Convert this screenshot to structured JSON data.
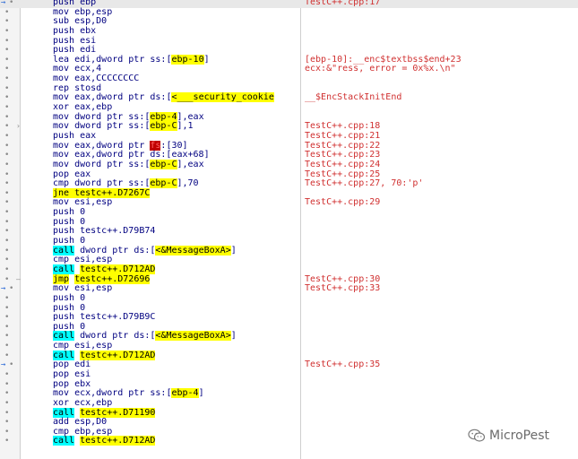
{
  "rows": [
    {
      "gutter": "arrow-dot",
      "ins": [
        {
          "t": "push ebp",
          "c": "blue"
        }
      ],
      "cmt": "TestC++.cpp:17",
      "sel": true
    },
    {
      "gutter": "dot",
      "ins": [
        {
          "t": "mov ebp,esp",
          "c": "blue"
        }
      ],
      "cmt": ""
    },
    {
      "gutter": "dot",
      "ins": [
        {
          "t": "sub esp,D0",
          "c": "blue"
        }
      ],
      "cmt": ""
    },
    {
      "gutter": "dot",
      "ins": [
        {
          "t": "push ebx",
          "c": "blue"
        }
      ],
      "cmt": ""
    },
    {
      "gutter": "dot",
      "ins": [
        {
          "t": "push esi",
          "c": "blue"
        }
      ],
      "cmt": ""
    },
    {
      "gutter": "dot",
      "ins": [
        {
          "t": "push edi",
          "c": "blue"
        }
      ],
      "cmt": ""
    },
    {
      "gutter": "dot",
      "ins": [
        {
          "t": "lea edi,dword ptr ss:",
          "c": "blue"
        },
        {
          "t": "[",
          "c": "blue"
        },
        {
          "t": "ebp-10",
          "c": "hl-y"
        },
        {
          "t": "]",
          "c": "blue"
        }
      ],
      "cmt": "[ebp-10]:__enc$textbss$end+23"
    },
    {
      "gutter": "dot",
      "ins": [
        {
          "t": "mov ecx,4",
          "c": "blue"
        }
      ],
      "cmt": "ecx:&\"ress, error = 0x%x.\\n\""
    },
    {
      "gutter": "dot",
      "ins": [
        {
          "t": "mov eax,CCCCCCCC",
          "c": "blue"
        }
      ],
      "cmt": ""
    },
    {
      "gutter": "dot",
      "ins": [
        {
          "t": "rep stosd",
          "c": "blue"
        }
      ],
      "cmt": ""
    },
    {
      "gutter": "dot",
      "ins": [
        {
          "t": "mov eax,dword ptr ds:",
          "c": "blue"
        },
        {
          "t": "[",
          "c": "blue"
        },
        {
          "t": "<___security_cookie",
          "c": "hl-y"
        }
      ],
      "cmt": "__$EncStackInitEnd"
    },
    {
      "gutter": "dot",
      "ins": [
        {
          "t": "xor eax,ebp",
          "c": "blue"
        }
      ],
      "cmt": ""
    },
    {
      "gutter": "dot",
      "ins": [
        {
          "t": "mov dword ptr ss:",
          "c": "blue"
        },
        {
          "t": "[",
          "c": "blue"
        },
        {
          "t": "ebp-4",
          "c": "hl-y"
        },
        {
          "t": "],eax",
          "c": "blue"
        }
      ],
      "cmt": ""
    },
    {
      "gutter": "dot-tick",
      "ins": [
        {
          "t": "mov dword ptr ss:",
          "c": "blue"
        },
        {
          "t": "[",
          "c": "blue"
        },
        {
          "t": "ebp-C",
          "c": "hl-y"
        },
        {
          "t": "],1",
          "c": "blue"
        }
      ],
      "cmt": "TestC++.cpp:18"
    },
    {
      "gutter": "dot",
      "ins": [
        {
          "t": "push eax",
          "c": "blue"
        }
      ],
      "cmt": "TestC++.cpp:21"
    },
    {
      "gutter": "dot",
      "ins": [
        {
          "t": "mov eax,dword ptr ",
          "c": "blue"
        },
        {
          "t": "fs",
          "c": "hl-r"
        },
        {
          "t": ":[30]",
          "c": "blue"
        }
      ],
      "cmt": "TestC++.cpp:22"
    },
    {
      "gutter": "dot",
      "ins": [
        {
          "t": "mov eax,dword ptr ds:[eax+68]",
          "c": "blue"
        }
      ],
      "cmt": "TestC++.cpp:23"
    },
    {
      "gutter": "dot",
      "ins": [
        {
          "t": "mov dword ptr ss:",
          "c": "blue"
        },
        {
          "t": "[",
          "c": "blue"
        },
        {
          "t": "ebp-C",
          "c": "hl-y"
        },
        {
          "t": "],eax",
          "c": "blue"
        }
      ],
      "cmt": "TestC++.cpp:24"
    },
    {
      "gutter": "dot",
      "ins": [
        {
          "t": "pop eax",
          "c": "blue"
        }
      ],
      "cmt": "TestC++.cpp:25"
    },
    {
      "gutter": "dot",
      "ins": [
        {
          "t": "cmp dword ptr ss:",
          "c": "blue"
        },
        {
          "t": "[",
          "c": "blue"
        },
        {
          "t": "ebp-C",
          "c": "hl-y"
        },
        {
          "t": "],70",
          "c": "blue"
        }
      ],
      "cmt": "TestC++.cpp:27, 70:'p'"
    },
    {
      "gutter": "dot",
      "ins": [
        {
          "t": "jne testc++.D7267C",
          "c": "hl-y"
        }
      ],
      "cmt": ""
    },
    {
      "gutter": "dot",
      "ins": [
        {
          "t": "mov esi,esp",
          "c": "blue"
        }
      ],
      "cmt": "TestC++.cpp:29"
    },
    {
      "gutter": "dot",
      "ins": [
        {
          "t": "push 0",
          "c": "blue"
        }
      ],
      "cmt": ""
    },
    {
      "gutter": "dot",
      "ins": [
        {
          "t": "push 0",
          "c": "blue"
        }
      ],
      "cmt": ""
    },
    {
      "gutter": "dot",
      "ins": [
        {
          "t": "push testc++.D79B74",
          "c": "blue"
        }
      ],
      "cmt": ""
    },
    {
      "gutter": "dot",
      "ins": [
        {
          "t": "push 0",
          "c": "blue"
        }
      ],
      "cmt": ""
    },
    {
      "gutter": "dot",
      "ins": [
        {
          "t": "call",
          "c": "hl-c"
        },
        {
          "t": " dword ptr ds:",
          "c": "blue"
        },
        {
          "t": "[",
          "c": "blue"
        },
        {
          "t": "<&MessageBoxA>",
          "c": "hl-y"
        },
        {
          "t": "]",
          "c": "blue"
        }
      ],
      "cmt": ""
    },
    {
      "gutter": "dot",
      "ins": [
        {
          "t": "cmp esi,esp",
          "c": "blue"
        }
      ],
      "cmt": ""
    },
    {
      "gutter": "dot",
      "ins": [
        {
          "t": "call",
          "c": "hl-c"
        },
        {
          "t": " ",
          "c": "blue"
        },
        {
          "t": "testc++.D712AD",
          "c": "hl-y"
        }
      ],
      "cmt": ""
    },
    {
      "gutter": "dot-dash",
      "ins": [
        {
          "t": "jmp",
          "c": "hl-y"
        },
        {
          "t": " ",
          "c": "blue"
        },
        {
          "t": "testc++.D72696",
          "c": "hl-y"
        }
      ],
      "cmt": "TestC++.cpp:30"
    },
    {
      "gutter": "arrow-dot",
      "ins": [
        {
          "t": "mov esi,esp",
          "c": "blue"
        }
      ],
      "cmt": "TestC++.cpp:33"
    },
    {
      "gutter": "dot",
      "ins": [
        {
          "t": "push 0",
          "c": "blue"
        }
      ],
      "cmt": ""
    },
    {
      "gutter": "dot",
      "ins": [
        {
          "t": "push 0",
          "c": "blue"
        }
      ],
      "cmt": ""
    },
    {
      "gutter": "dot",
      "ins": [
        {
          "t": "push testc++.D79B9C",
          "c": "blue"
        }
      ],
      "cmt": ""
    },
    {
      "gutter": "dot",
      "ins": [
        {
          "t": "push 0",
          "c": "blue"
        }
      ],
      "cmt": ""
    },
    {
      "gutter": "dot",
      "ins": [
        {
          "t": "call",
          "c": "hl-c"
        },
        {
          "t": " dword ptr ds:",
          "c": "blue"
        },
        {
          "t": "[",
          "c": "blue"
        },
        {
          "t": "<&MessageBoxA>",
          "c": "hl-y"
        },
        {
          "t": "]",
          "c": "blue"
        }
      ],
      "cmt": ""
    },
    {
      "gutter": "dot",
      "ins": [
        {
          "t": "cmp esi,esp",
          "c": "blue"
        }
      ],
      "cmt": ""
    },
    {
      "gutter": "dot",
      "ins": [
        {
          "t": "call",
          "c": "hl-c"
        },
        {
          "t": " ",
          "c": "blue"
        },
        {
          "t": "testc++.D712AD",
          "c": "hl-y"
        }
      ],
      "cmt": ""
    },
    {
      "gutter": "arrow-dot",
      "ins": [
        {
          "t": "pop edi",
          "c": "blue"
        }
      ],
      "cmt": "TestC++.cpp:35"
    },
    {
      "gutter": "dot",
      "ins": [
        {
          "t": "pop esi",
          "c": "blue"
        }
      ],
      "cmt": ""
    },
    {
      "gutter": "dot",
      "ins": [
        {
          "t": "pop ebx",
          "c": "blue"
        }
      ],
      "cmt": ""
    },
    {
      "gutter": "dot",
      "ins": [
        {
          "t": "mov ecx,dword ptr ss:",
          "c": "blue"
        },
        {
          "t": "[",
          "c": "blue"
        },
        {
          "t": "ebp-4",
          "c": "hl-y"
        },
        {
          "t": "]",
          "c": "blue"
        }
      ],
      "cmt": ""
    },
    {
      "gutter": "dot",
      "ins": [
        {
          "t": "xor ecx,ebp",
          "c": "blue"
        }
      ],
      "cmt": ""
    },
    {
      "gutter": "dot",
      "ins": [
        {
          "t": "call",
          "c": "hl-c"
        },
        {
          "t": " ",
          "c": "blue"
        },
        {
          "t": "testc++.D71190",
          "c": "hl-y"
        }
      ],
      "cmt": ""
    },
    {
      "gutter": "dot",
      "ins": [
        {
          "t": "add esp,D0",
          "c": "blue"
        }
      ],
      "cmt": ""
    },
    {
      "gutter": "dot",
      "ins": [
        {
          "t": "cmp ebp,esp",
          "c": "blue"
        }
      ],
      "cmt": ""
    },
    {
      "gutter": "dot",
      "ins": [
        {
          "t": "call",
          "c": "hl-c"
        },
        {
          "t": " ",
          "c": "blue"
        },
        {
          "t": "testc++.D712AD",
          "c": "hl-y"
        }
      ],
      "cmt": ""
    }
  ],
  "watermark": {
    "text": "MicroPest",
    "icon": "wechat-icon"
  },
  "colors": {
    "instruction": "#000080",
    "comment": "#d03030",
    "highlight_yellow": "#ffff00",
    "highlight_cyan": "#00ffff",
    "highlight_red": "#c00000"
  }
}
